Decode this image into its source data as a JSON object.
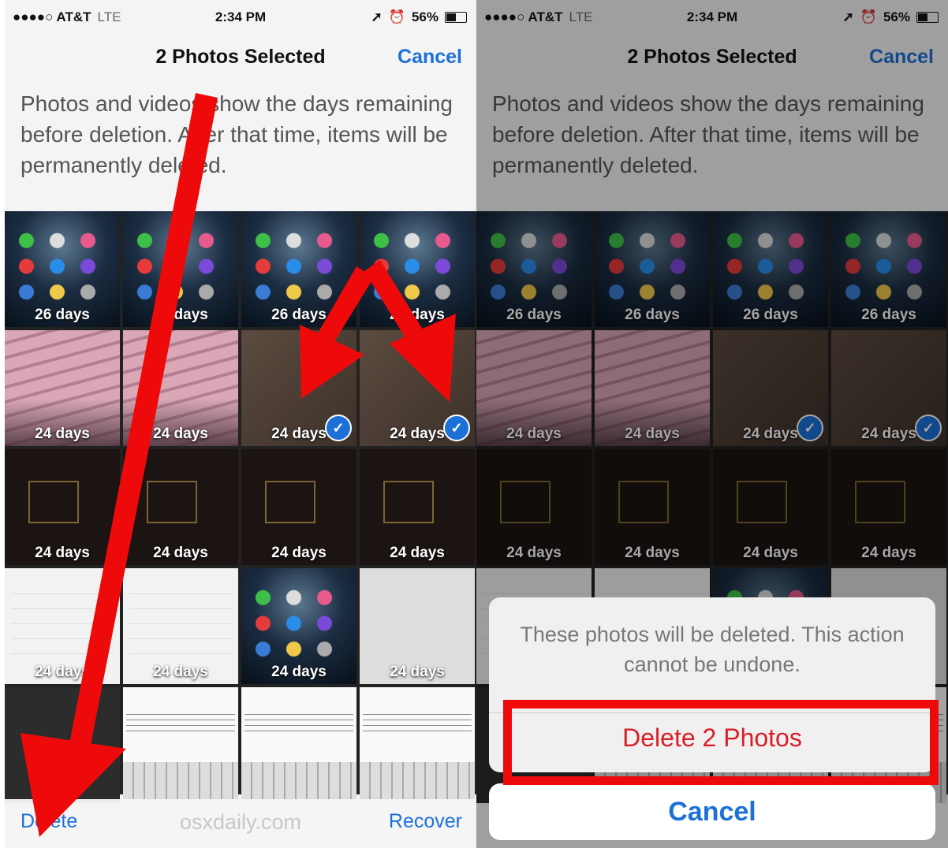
{
  "status_bar": {
    "carrier": "●●●●○ AT&T",
    "network": "LTE",
    "time": "2:34 PM",
    "battery": "56%",
    "battery_level": 0.56
  },
  "nav": {
    "title": "2 Photos Selected",
    "cancel": "Cancel"
  },
  "info_text": "Photos and videos show the days remaining before deletion. After that time, items will be permanently deleted.",
  "tiles": [
    {
      "days": "26 days",
      "kind": "home",
      "selected": false
    },
    {
      "days": "26 days",
      "kind": "home",
      "selected": false
    },
    {
      "days": "26 days",
      "kind": "home",
      "selected": false
    },
    {
      "days": "26 days",
      "kind": "home",
      "selected": false
    },
    {
      "days": "24 days",
      "kind": "keyboard",
      "selected": false
    },
    {
      "days": "24 days",
      "kind": "keyboard",
      "selected": false
    },
    {
      "days": "24 days",
      "kind": "brown",
      "selected": true
    },
    {
      "days": "24 days",
      "kind": "brown",
      "selected": true
    },
    {
      "days": "24 days",
      "kind": "camera",
      "selected": false
    },
    {
      "days": "24 days",
      "kind": "camera",
      "selected": false
    },
    {
      "days": "24 days",
      "kind": "camera",
      "selected": false
    },
    {
      "days": "24 days",
      "kind": "camera",
      "selected": false
    },
    {
      "days": "24 days",
      "kind": "settings",
      "selected": false
    },
    {
      "days": "24 days",
      "kind": "settings",
      "selected": false
    },
    {
      "days": "24 days",
      "kind": "home",
      "selected": false
    },
    {
      "days": "24 days",
      "kind": "settings-dark",
      "selected": false
    },
    {
      "days": "",
      "kind": "darkphoto",
      "selected": false
    },
    {
      "days": "",
      "kind": "email",
      "selected": false
    },
    {
      "days": "",
      "kind": "email",
      "selected": false
    },
    {
      "days": "",
      "kind": "email",
      "selected": false
    }
  ],
  "toolbar": {
    "delete": "Delete",
    "watermark": "osxdaily.com",
    "recover": "Recover"
  },
  "alert": {
    "message": "These photos will be deleted. This action cannot be undone.",
    "delete_button": "Delete 2 Photos",
    "cancel_button": "Cancel"
  },
  "colors": {
    "ios_blue": "#1c70d8",
    "destructive_red": "#d91e26",
    "annotation_red": "#ee0a0a"
  },
  "icons": {
    "selected": "checkmark-circle-icon",
    "annotation": "red-arrow-icon"
  }
}
